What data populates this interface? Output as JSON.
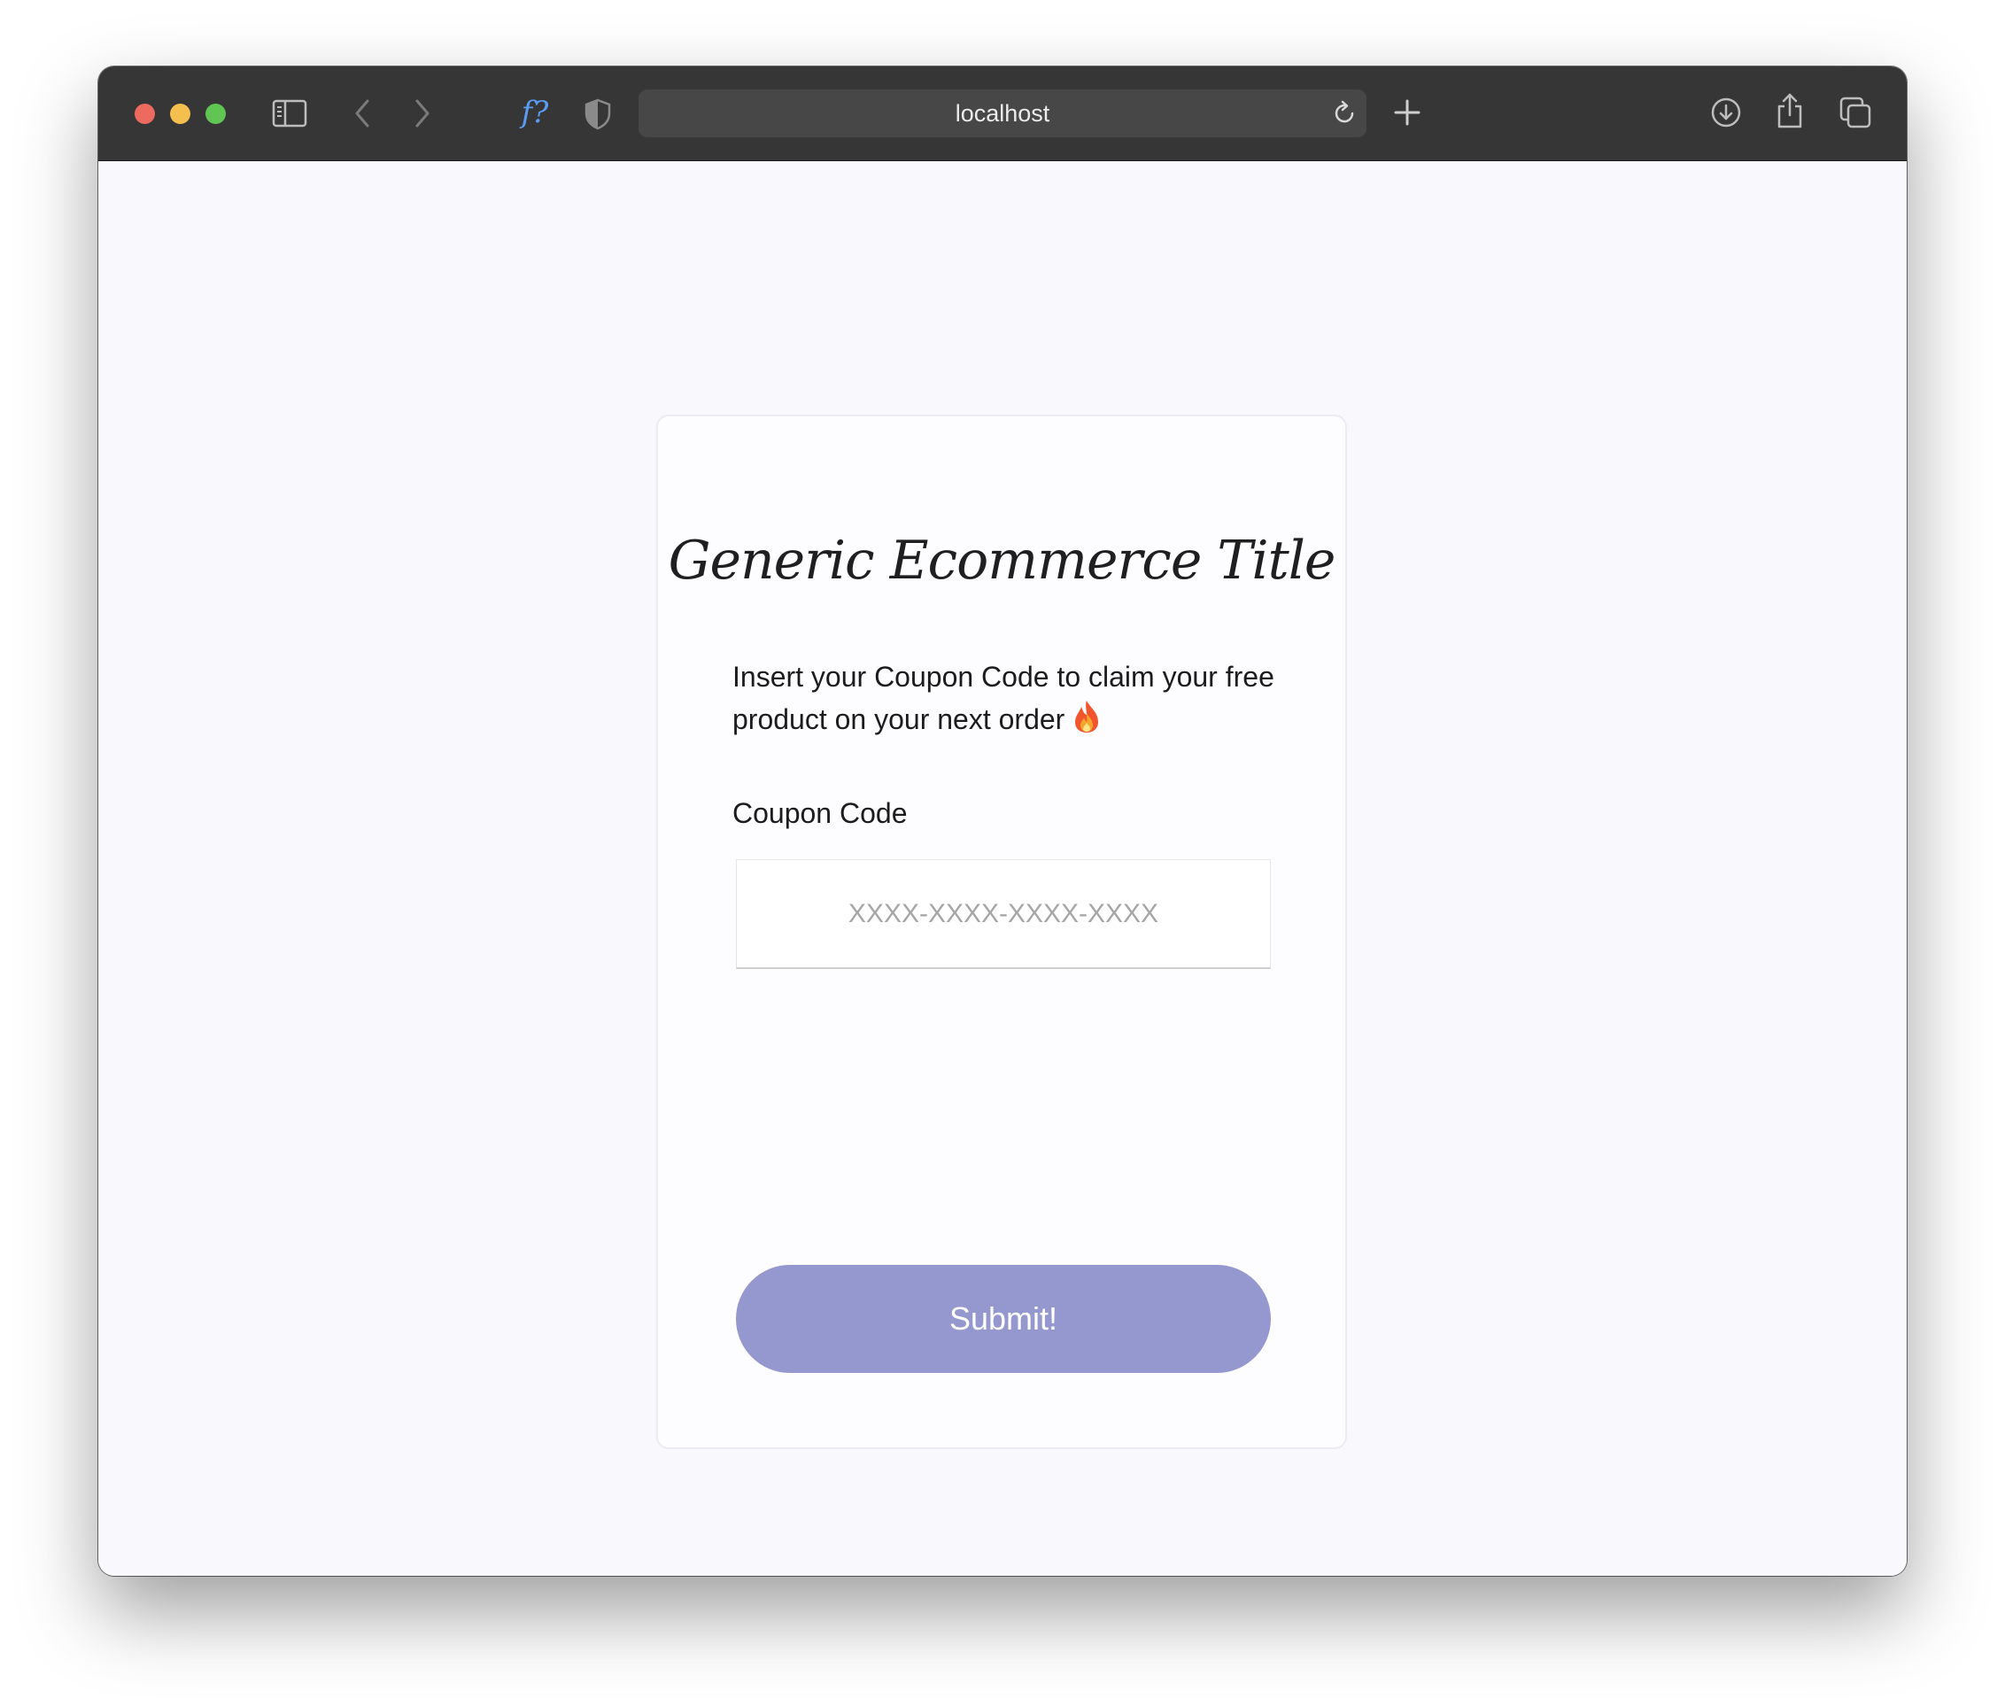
{
  "browser": {
    "address": "localhost",
    "extension_label": "f?",
    "icons": {
      "sidebar": "sidebar-icon",
      "back": "chevron-left-icon",
      "forward": "chevron-right-icon",
      "shield": "shield-icon",
      "reload": "reload-icon",
      "new_tab": "plus-icon",
      "download": "download-icon",
      "share": "share-icon",
      "tabs": "tabs-overview-icon"
    }
  },
  "card": {
    "title": "Generic Ecommerce Title",
    "description": "Insert your Coupon Code to claim your free product on your next order",
    "description_icon": "fire-icon",
    "coupon_label": "Coupon Code",
    "coupon_value": "",
    "coupon_placeholder": "XXXX-XXXX-XXXX-XXXX",
    "submit_label": "Submit!"
  },
  "colors": {
    "page_background": "#f9f8fd",
    "card_background": "#fdfcfe",
    "submit_button": "#9597cf",
    "toolbar": "#363636",
    "address_bar": "#474747"
  }
}
